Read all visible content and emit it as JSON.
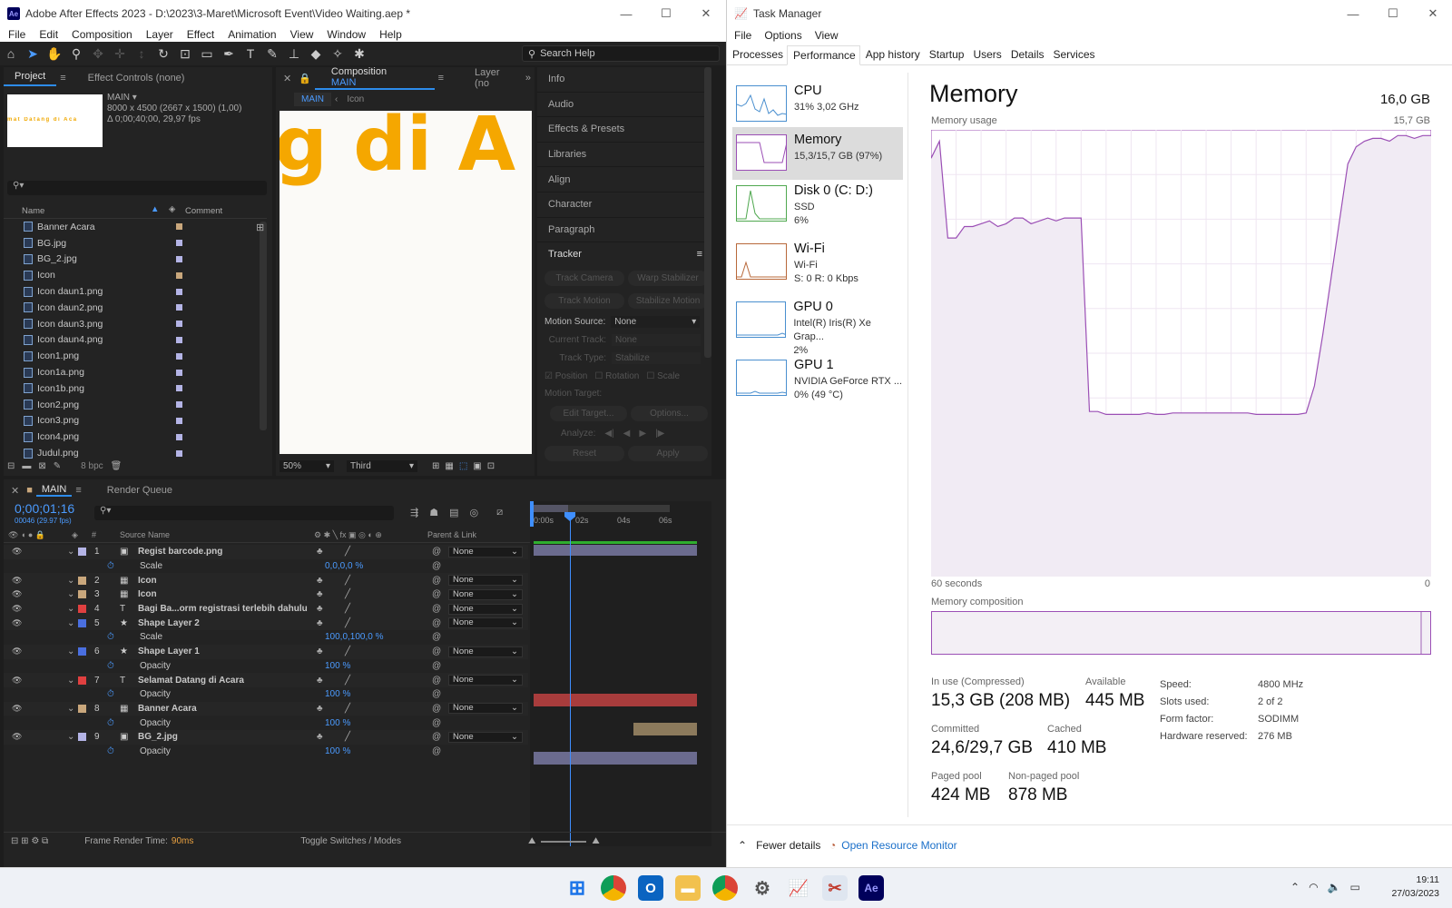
{
  "ae": {
    "title": "Adobe After Effects 2023 - D:\\2023\\3-Maret\\Microsoft Event\\Video Waiting.aep *",
    "logo": "Ae",
    "menu": [
      "File",
      "Edit",
      "Composition",
      "Layer",
      "Effect",
      "Animation",
      "View",
      "Window",
      "Help"
    ],
    "search_help": "Search Help",
    "project_tab": "Project",
    "effect_controls_tab": "Effect Controls (none)",
    "comp_name": "MAIN",
    "comp_info1": "8000 x 4500  (2667 x 1500) (1,00)",
    "comp_info2": "Δ 0;00;40;00, 29,97 fps",
    "thumb_text": "mat Datang di Aca",
    "col_name": "Name",
    "col_comment": "Comment",
    "project_items": [
      {
        "name": "Banner Acara",
        "label_color": "#c9a77c"
      },
      {
        "name": "BG.jpg",
        "label_color": "#b4b4e6"
      },
      {
        "name": "BG_2.jpg",
        "label_color": "#b4b4e6"
      },
      {
        "name": "Icon",
        "label_color": "#c9a77c"
      },
      {
        "name": "Icon daun1.png",
        "label_color": "#b4b4e6"
      },
      {
        "name": "Icon daun2.png",
        "label_color": "#b4b4e6"
      },
      {
        "name": "Icon daun3.png",
        "label_color": "#b4b4e6"
      },
      {
        "name": "Icon daun4.png",
        "label_color": "#b4b4e6"
      },
      {
        "name": "Icon1.png",
        "label_color": "#b4b4e6"
      },
      {
        "name": "Icon1a.png",
        "label_color": "#b4b4e6"
      },
      {
        "name": "Icon1b.png",
        "label_color": "#b4b4e6"
      },
      {
        "name": "Icon2.png",
        "label_color": "#b4b4e6"
      },
      {
        "name": "Icon3.png",
        "label_color": "#b4b4e6"
      },
      {
        "name": "Icon4.png",
        "label_color": "#b4b4e6"
      },
      {
        "name": "Judul.png",
        "label_color": "#b4b4e6"
      }
    ],
    "bpc": "8 bpc",
    "comp_tab": "Composition",
    "comp_tab_name": "MAIN",
    "layer_tab": "Layer (no",
    "crumb_main": "MAIN",
    "crumb_icon": "Icon",
    "viewer_text": "g di A",
    "zoom": "50%",
    "view_mode": "Third",
    "right_panels": [
      "Info",
      "Audio",
      "Effects & Presets",
      "Libraries",
      "Align",
      "Character",
      "Paragraph"
    ],
    "tracker": {
      "title": "Tracker",
      "btn_track_camera": "Track Camera",
      "btn_warp": "Warp Stabilizer",
      "btn_track_motion": "Track Motion",
      "btn_stabilize": "Stabilize Motion",
      "motion_source_label": "Motion Source:",
      "motion_source_value": "None",
      "current_track_label": "Current Track:",
      "current_track_value": "None",
      "track_type_label": "Track Type:",
      "track_type_value": "Stabilize",
      "chk_position": "Position",
      "chk_rotation": "Rotation",
      "chk_scale": "Scale",
      "motion_target": "Motion Target:",
      "btn_edit_target": "Edit Target...",
      "btn_options": "Options...",
      "analyze": "Analyze:",
      "btn_reset": "Reset",
      "btn_apply": "Apply"
    },
    "timeline": {
      "tab": "MAIN",
      "render_queue": "Render Queue",
      "timecode": "0;00;01;16",
      "frames": "00046 (29.97 fps)",
      "col_source": "Source Name",
      "col_parent": "Parent & Link",
      "ruler": [
        "0:00s",
        "02s",
        "04s",
        "06s"
      ],
      "rows": [
        {
          "type": "layer",
          "num": "1",
          "name": "Regist barcode.png",
          "color": "#b4b4e6",
          "parent": "None",
          "icon": "▣"
        },
        {
          "type": "prop",
          "name": "Scale",
          "value": "0,0,0,0 %"
        },
        {
          "type": "layer",
          "num": "2",
          "name": "Icon",
          "color": "#c9a77c",
          "parent": "None",
          "icon": "▦"
        },
        {
          "type": "layer",
          "num": "3",
          "name": "Icon",
          "color": "#c9a77c",
          "parent": "None",
          "icon": "▦"
        },
        {
          "type": "layer",
          "num": "4",
          "name": "Bagi Ba...orm registrasi terlebih dahulu",
          "color": "#e04040",
          "parent": "None",
          "icon": "T"
        },
        {
          "type": "layer",
          "num": "5",
          "name": "Shape Layer 2",
          "color": "#4a6fe0",
          "parent": "None",
          "icon": "★"
        },
        {
          "type": "prop",
          "name": "Scale",
          "value": "100,0,100,0 %"
        },
        {
          "type": "layer",
          "num": "6",
          "name": "Shape Layer 1",
          "color": "#4a6fe0",
          "parent": "None",
          "icon": "★"
        },
        {
          "type": "prop",
          "name": "Opacity",
          "value": "100 %"
        },
        {
          "type": "layer",
          "num": "7",
          "name": "Selamat Datang di Acara",
          "color": "#e04040",
          "parent": "None",
          "icon": "T"
        },
        {
          "type": "prop",
          "name": "Opacity",
          "value": "100 %"
        },
        {
          "type": "layer",
          "num": "8",
          "name": "Banner Acara",
          "color": "#c9a77c",
          "parent": "None",
          "icon": "▦"
        },
        {
          "type": "prop",
          "name": "Opacity",
          "value": "100 %"
        },
        {
          "type": "layer",
          "num": "9",
          "name": "BG_2.jpg",
          "color": "#b4b4e6",
          "parent": "None",
          "icon": "▣"
        },
        {
          "type": "prop",
          "name": "Opacity",
          "value": "100 %"
        }
      ],
      "frame_render_label": "Frame Render Time:",
      "frame_render_value": "90ms",
      "toggle_switches": "Toggle Switches / Modes"
    }
  },
  "tm": {
    "title": "Task Manager",
    "menu": [
      "File",
      "Options",
      "View"
    ],
    "tabs": [
      "Processes",
      "Performance",
      "App history",
      "Startup",
      "Users",
      "Details",
      "Services"
    ],
    "perf_items": [
      {
        "name": "CPU",
        "l1": "31%  3,02 GHz",
        "l2": "",
        "l3": "",
        "color": "#4a8fcf"
      },
      {
        "name": "Memory",
        "l1": "15,3/15,7 GB (97%)",
        "l2": "",
        "l3": "",
        "color": "#9b4fb5"
      },
      {
        "name": "Disk 0 (C: D:)",
        "l1": "SSD",
        "l2": "6%",
        "l3": "",
        "color": "#4fa84f"
      },
      {
        "name": "Wi-Fi",
        "l1": "Wi-Fi",
        "l2": "S: 0  R: 0 Kbps",
        "l3": "",
        "color": "#b8683a"
      },
      {
        "name": "GPU 0",
        "l1": "Intel(R) Iris(R) Xe Grap...",
        "l2": "2%",
        "l3": "",
        "color": "#4a8fcf"
      },
      {
        "name": "GPU 1",
        "l1": "NVIDIA GeForce RTX ...",
        "l2": "0%  (49 °C)",
        "l3": "",
        "color": "#4a8fcf"
      }
    ],
    "memory_title": "Memory",
    "memory_total": "16,0 GB",
    "usage_label": "Memory usage",
    "usage_max": "15,7 GB",
    "axis_left": "60 seconds",
    "axis_right": "0",
    "composition_label": "Memory composition",
    "in_use_label": "In use (Compressed)",
    "in_use_value": "15,3 GB (208 MB)",
    "available_label": "Available",
    "available_value": "445 MB",
    "committed_label": "Committed",
    "committed_value": "24,6/29,7 GB",
    "cached_label": "Cached",
    "cached_value": "410 MB",
    "paged_label": "Paged pool",
    "paged_value": "424 MB",
    "nonpaged_label": "Non-paged pool",
    "nonpaged_value": "878 MB",
    "speed_label": "Speed:",
    "speed_value": "4800 MHz",
    "slots_label": "Slots used:",
    "slots_value": "2 of 2",
    "form_label": "Form factor:",
    "form_value": "SODIMM",
    "hw_label": "Hardware reserved:",
    "hw_value": "276 MB",
    "fewer_details": "Fewer details",
    "open_monitor": "Open Resource Monitor"
  },
  "taskbar": {
    "time": "19:11",
    "date": "27/03/2023"
  },
  "chart_data": {
    "type": "area",
    "title": "Memory usage",
    "ylabel": "",
    "xlabel": "",
    "x_range_seconds": [
      60,
      0
    ],
    "ylim": [
      0,
      15.7
    ],
    "x": [
      60,
      59,
      58,
      57,
      56,
      55,
      54,
      53,
      52,
      51,
      50,
      49,
      48,
      47,
      46,
      45,
      44,
      43,
      42,
      41,
      40,
      39,
      38,
      37,
      36,
      35,
      34,
      33,
      32,
      31,
      30,
      29,
      28,
      27,
      26,
      25,
      24,
      23,
      22,
      21,
      20,
      19,
      18,
      17,
      16,
      15,
      14,
      13,
      12,
      11,
      10,
      9,
      8,
      7,
      6,
      5,
      4,
      3,
      2,
      1,
      0
    ],
    "values": [
      14.7,
      15.3,
      11.9,
      11.9,
      12.3,
      12.3,
      12.4,
      12.5,
      12.3,
      12.4,
      12.6,
      12.6,
      12.4,
      12.5,
      12.6,
      12.5,
      12.6,
      12.6,
      12.6,
      5.8,
      5.8,
      5.7,
      5.7,
      5.7,
      5.7,
      5.7,
      5.75,
      5.7,
      5.7,
      5.75,
      5.75,
      5.75,
      5.75,
      5.75,
      5.75,
      5.75,
      5.75,
      5.75,
      5.75,
      5.7,
      5.7,
      5.7,
      5.7,
      5.7,
      5.7,
      5.75,
      6.7,
      8.5,
      10.5,
      12.5,
      14.5,
      15.1,
      15.3,
      15.4,
      15.4,
      15.3,
      15.5,
      15.5,
      15.4,
      15.5,
      15.5
    ],
    "grid": true,
    "color": "#9b4fb5"
  }
}
